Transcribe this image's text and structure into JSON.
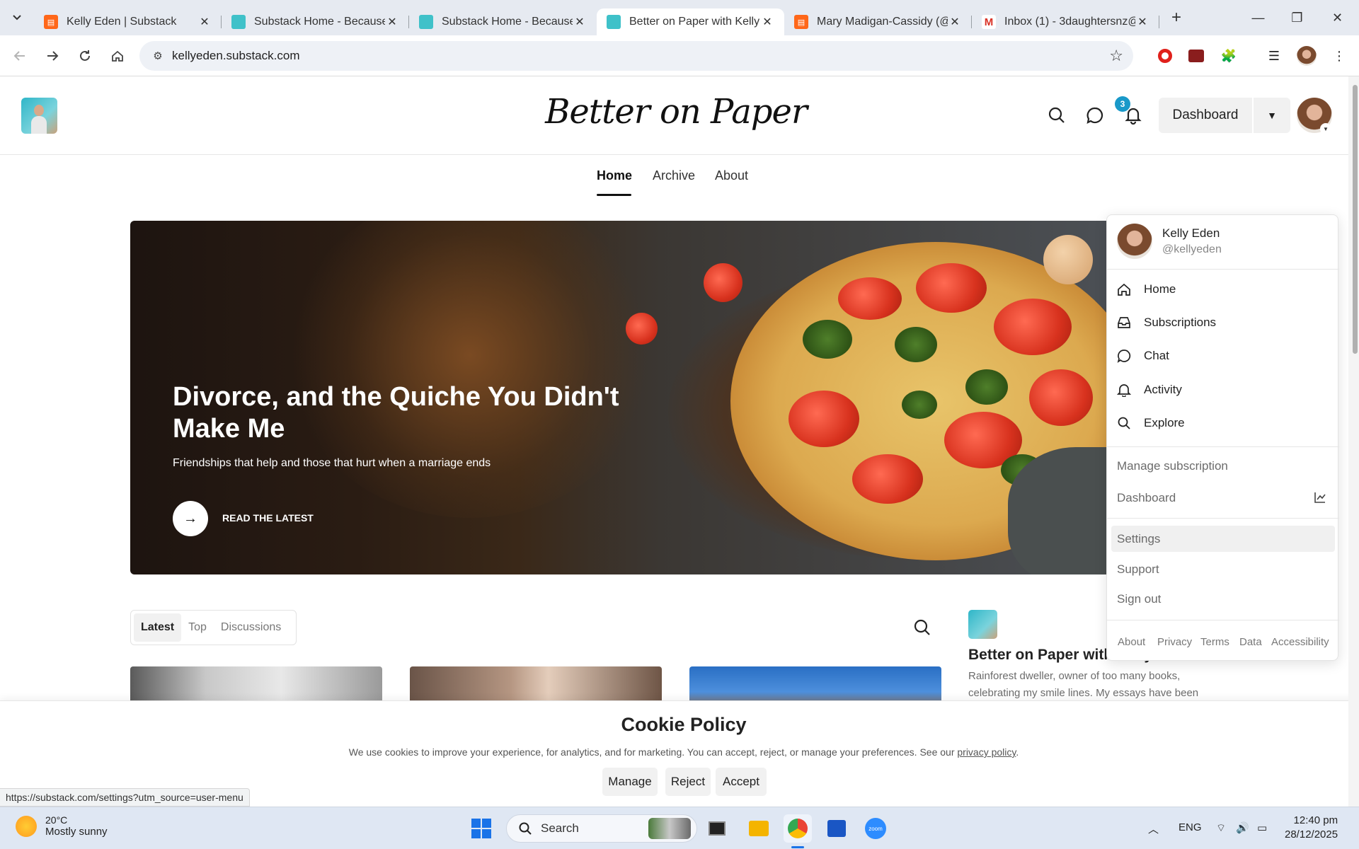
{
  "browser": {
    "tabs": [
      {
        "title": "Kelly Eden | Substack",
        "icon": "substack-icon"
      },
      {
        "title": "Substack Home - Because",
        "icon": "substack-home-icon"
      },
      {
        "title": "Substack Home - Because",
        "icon": "substack-home-icon"
      },
      {
        "title": "Better on Paper with Kelly E",
        "icon": "publication-icon"
      },
      {
        "title": "Mary Madigan-Cassidy (@",
        "icon": "substack-icon"
      },
      {
        "title": "Inbox (1) - 3daughtersnz@",
        "icon": "gmail-icon"
      }
    ],
    "url": "kellyeden.substack.com",
    "status_url": "https://substack.com/settings?utm_source=user-menu"
  },
  "publication": {
    "title": "Better on Paper",
    "chat_badge": "3",
    "dashboard_label": "Dashboard",
    "nav": [
      "Home",
      "Archive",
      "About"
    ]
  },
  "hero": {
    "title": "Divorce, and the Quiche You Didn't Make Me",
    "subtitle": "Friendships that help and those that hurt when a marriage ends",
    "cta": "READ THE LATEST"
  },
  "feed": {
    "tabs": [
      "Latest",
      "Top",
      "Discussions"
    ]
  },
  "sidebar": {
    "title": "Better on Paper with Kelly Eden",
    "description": "Rainforest dweller, owner of too many books, celebrating my smile lines. My essays have been"
  },
  "user_menu": {
    "name": "Kelly Eden",
    "handle": "@kellyeden",
    "primary": [
      {
        "label": "Home",
        "icon": "home-icon"
      },
      {
        "label": "Subscriptions",
        "icon": "inbox-icon"
      },
      {
        "label": "Chat",
        "icon": "chat-icon"
      },
      {
        "label": "Activity",
        "icon": "bell-icon"
      },
      {
        "label": "Explore",
        "icon": "search-icon"
      }
    ],
    "secondary": [
      "Manage subscription",
      "Dashboard"
    ],
    "tertiary": [
      "Settings",
      "Support",
      "Sign out"
    ],
    "footer": [
      "About",
      "Privacy",
      "Terms",
      "Data",
      "Accessibility"
    ]
  },
  "cookie": {
    "title": "Cookie Policy",
    "text": "We use cookies to improve your experience, for analytics, and for marketing. You can accept, reject, or manage your preferences. See our",
    "link": "privacy policy",
    "end": ".",
    "buttons": [
      "Manage",
      "Reject",
      "Accept"
    ]
  },
  "taskbar": {
    "temperature": "20°C",
    "condition": "Mostly sunny",
    "search_label": "Search",
    "language": "ENG",
    "time": "12:40 pm",
    "date": "28/12/2025"
  },
  "colors": {
    "accent": "#1999c9",
    "substack_orange": "#ff6719"
  }
}
